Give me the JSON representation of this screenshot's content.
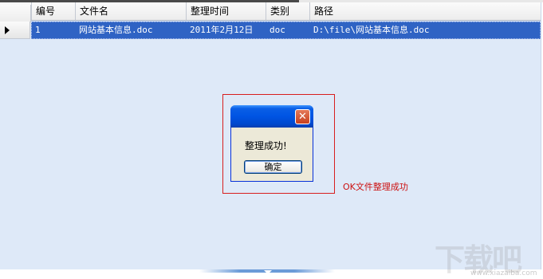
{
  "grid": {
    "columns": [
      "编号",
      "文件名",
      "整理时间",
      "类别",
      "路径"
    ],
    "rows": [
      {
        "id": "1",
        "filename": "网站基本信息.doc",
        "time": "2011年2月12日",
        "type": "doc",
        "path": "D:\\file\\网站基本信息.doc"
      }
    ],
    "selected_row_color": "#2f63c4",
    "background_color": "#dee9f8"
  },
  "dialog": {
    "message": "整理成功!",
    "ok_label": "确定",
    "close_glyph": "✕",
    "titlebar_color": "#0054e3"
  },
  "annotation": {
    "text": "OK文件整理成功",
    "color": "#cc1111"
  },
  "watermark": {
    "text": "下载吧",
    "url": "www.xiazaiba.com"
  }
}
